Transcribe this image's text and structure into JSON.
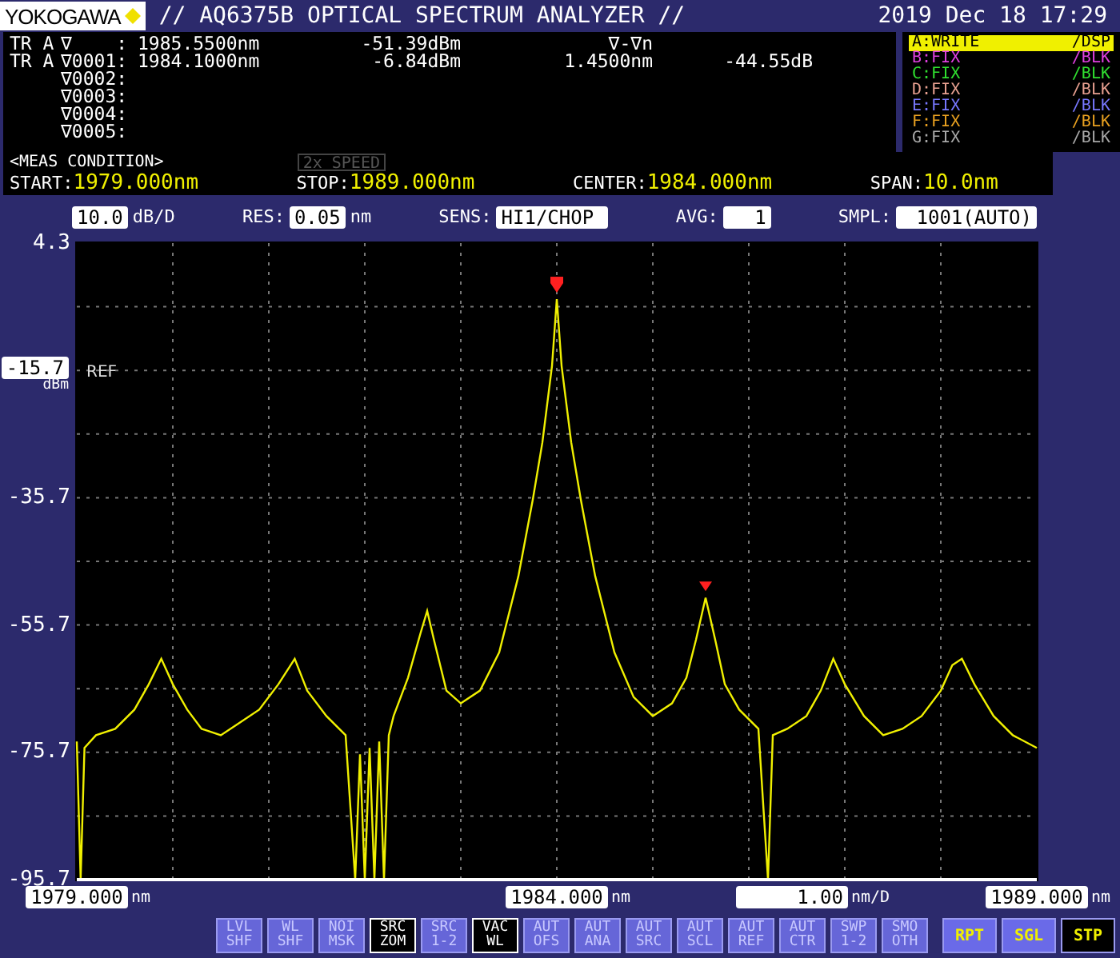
{
  "header": {
    "logo": "YOKOGAWA",
    "title": "// AQ6375B OPTICAL SPECTRUM ANALYZER //",
    "datetime": "2019 Dec 18 17:29"
  },
  "marker_rows": [
    {
      "trace": "TR A",
      "marker": "∇    :",
      "wavelength": "1985.5500nm",
      "level": "-51.39dBm",
      "delta_wavelength": "∇-∇n"
    },
    {
      "trace": "TR A",
      "marker": "∇0001:",
      "wavelength": "1984.1000nm",
      "level": "-6.84dBm",
      "delta_wavelength": "1.4500nm",
      "delta_level": "-44.55dB"
    },
    {
      "marker": "∇0002:"
    },
    {
      "marker": "∇0003:"
    },
    {
      "marker": "∇0004:"
    },
    {
      "marker": "∇0005:"
    }
  ],
  "traces": [
    {
      "mode": "A:WRITE",
      "display": "/DSP",
      "color": "#f0f000",
      "selected": true
    },
    {
      "mode": "B:FIX",
      "display": "/BLK",
      "color": "#e040e0",
      "selected": false
    },
    {
      "mode": "C:FIX",
      "display": "/BLK",
      "color": "#30e030",
      "selected": false
    },
    {
      "mode": "D:FIX",
      "display": "/BLK",
      "color": "#e8a090",
      "selected": false
    },
    {
      "mode": "E:FIX",
      "display": "/BLK",
      "color": "#7878ff",
      "selected": false
    },
    {
      "mode": "F:FIX",
      "display": "/BLK",
      "color": "#e8a020",
      "selected": false
    },
    {
      "mode": "G:FIX",
      "display": "/BLK",
      "color": "#a8a8a8",
      "selected": false
    }
  ],
  "meas_condition": {
    "heading": "<MEAS CONDITION>",
    "speed": {
      "label": "2x SPEED",
      "active": false
    },
    "items": [
      {
        "label": "START:",
        "value": "1979.000nm"
      },
      {
        "label": "STOP:",
        "value": "1989.000nm"
      },
      {
        "label": "CENTER:",
        "value": "1984.000nm"
      },
      {
        "label": "SPAN:",
        "value": "10.0nm"
      }
    ]
  },
  "settings": [
    {
      "value": "10.0",
      "unit": "dB/D"
    },
    {
      "label": "RES:",
      "value": "0.05",
      "unit": "nm"
    },
    {
      "label": "SENS:",
      "value": "HI1/CHOP"
    },
    {
      "label": "AVG:",
      "value": "1"
    },
    {
      "label": "SMPL:",
      "value": "1001(AUTO)"
    }
  ],
  "reference": {
    "value": "-15.7",
    "unit": "dBm",
    "tag": "REF"
  },
  "chart_data": {
    "type": "line",
    "grid": true,
    "xlim": [
      1979,
      1989
    ],
    "ylim": [
      -95.7,
      4.3
    ],
    "xticks": [
      {
        "value": 1979,
        "label": "1979.000"
      },
      {
        "value": 1984,
        "label": "1984.000"
      },
      {
        "value": 1989,
        "label": "1989.000"
      }
    ],
    "yticks": [
      {
        "value": 4.3,
        "label": "4.3"
      },
      {
        "value": -35.7,
        "label": "-35.7"
      },
      {
        "value": -55.7,
        "label": "-55.7"
      },
      {
        "value": -75.7,
        "label": "-75.7"
      },
      {
        "value": -95.7,
        "label": "-95.7"
      }
    ],
    "x": [
      1979.0,
      1979.04,
      1979.08,
      1979.2,
      1979.4,
      1979.6,
      1979.75,
      1979.88,
      1980.0,
      1980.15,
      1980.3,
      1980.5,
      1980.7,
      1980.9,
      1981.1,
      1981.27,
      1981.4,
      1981.6,
      1981.8,
      1981.9,
      1981.95,
      1982.0,
      1982.05,
      1982.1,
      1982.15,
      1982.2,
      1982.25,
      1982.3,
      1982.45,
      1982.58,
      1982.65,
      1982.72,
      1982.85,
      1983.0,
      1983.2,
      1983.4,
      1983.6,
      1983.75,
      1983.85,
      1983.95,
      1984.0,
      1984.05,
      1984.15,
      1984.25,
      1984.4,
      1984.6,
      1984.8,
      1985.0,
      1985.2,
      1985.35,
      1985.45,
      1985.55,
      1985.65,
      1985.75,
      1985.9,
      1986.1,
      1986.2,
      1986.25,
      1986.4,
      1986.6,
      1986.75,
      1986.88,
      1987.0,
      1987.2,
      1987.4,
      1987.6,
      1987.8,
      1988.0,
      1988.12,
      1988.22,
      1988.35,
      1988.55,
      1988.75,
      1989.0
    ],
    "series": [
      {
        "color": "#f0f000",
        "values": [
          -74,
          -95.7,
          -75,
          -73,
          -72,
          -69,
          -65,
          -61,
          -65,
          -69,
          -72,
          -73,
          -71,
          -69,
          -65,
          -61,
          -66,
          -70,
          -73,
          -95.7,
          -76,
          -95.7,
          -75,
          -95.7,
          -74,
          -95.7,
          -73,
          -70,
          -64,
          -57,
          -53.5,
          -58,
          -66,
          -68,
          -66,
          -60,
          -48,
          -36,
          -27,
          -15,
          -4.5,
          -15,
          -27,
          -36,
          -48,
          -60,
          -67,
          -70,
          -68,
          -64,
          -58,
          -51.4,
          -58,
          -65,
          -69,
          -72,
          -95.7,
          -73,
          -72,
          -70,
          -66,
          -61,
          -65,
          -70,
          -73,
          -72,
          -70,
          -66,
          -62,
          -61,
          -65,
          -70,
          -73,
          -75
        ]
      }
    ]
  },
  "x_axis": {
    "tick_units": [
      "nm",
      "nm",
      "nm"
    ],
    "scale": {
      "value": "1.00",
      "unit": "nm/D"
    }
  },
  "soft_keys": [
    {
      "line1": "LVL",
      "line2": "SHF",
      "selected": false
    },
    {
      "line1": "WL",
      "line2": "SHF",
      "selected": false
    },
    {
      "line1": "NOI",
      "line2": "MSK",
      "selected": false
    },
    {
      "line1": "SRC",
      "line2": "ZOM",
      "selected": true
    },
    {
      "line1": "SRC",
      "line2": "1-2",
      "selected": false
    },
    {
      "line1": "VAC",
      "line2": "WL",
      "selected": true
    },
    {
      "line1": "AUT",
      "line2": "OFS",
      "selected": false
    },
    {
      "line1": "AUT",
      "line2": "ANA",
      "selected": false
    },
    {
      "line1": "AUT",
      "line2": "SRC",
      "selected": false
    },
    {
      "line1": "AUT",
      "line2": "SCL",
      "selected": false
    },
    {
      "line1": "AUT",
      "line2": "REF",
      "selected": false
    },
    {
      "line1": "AUT",
      "line2": "CTR",
      "selected": false
    },
    {
      "line1": "SWP",
      "line2": "1-2",
      "selected": false
    },
    {
      "line1": "SMO",
      "line2": "OTH",
      "selected": false
    }
  ],
  "sweep_keys": [
    {
      "label": "RPT",
      "selected": false
    },
    {
      "label": "SGL",
      "selected": false
    },
    {
      "label": "STP",
      "selected": true
    }
  ]
}
